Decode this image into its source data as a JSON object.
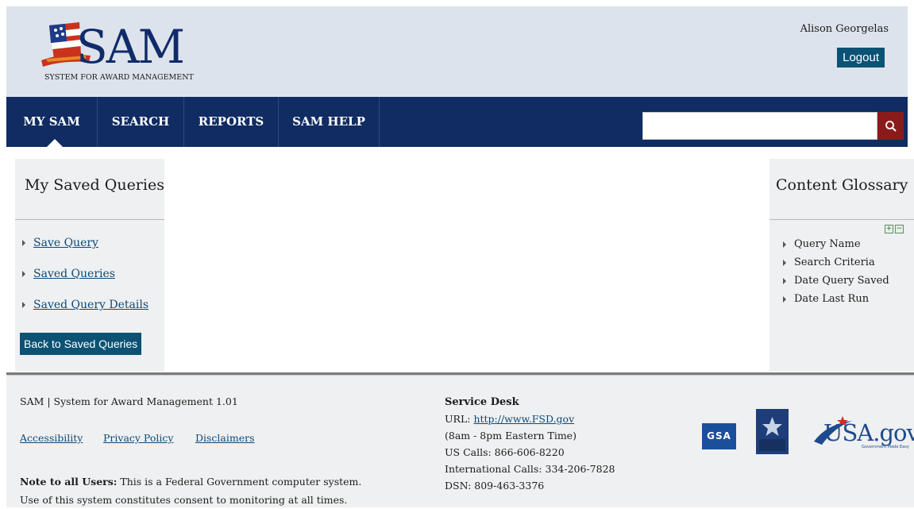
{
  "header": {
    "logo_text": "SAM",
    "logo_subtitle": "SYSTEM FOR AWARD MANAGEMENT",
    "user_name": "Alison Georgelas",
    "logout_label": "Logout"
  },
  "nav": {
    "items": [
      {
        "label": "MY SAM"
      },
      {
        "label": "SEARCH"
      },
      {
        "label": "REPORTS"
      },
      {
        "label": "SAM HELP"
      }
    ],
    "active": "MY SAM",
    "search_value": "",
    "search_icon": "magnifier-icon"
  },
  "left_panel": {
    "title": "My Saved Queries",
    "links": [
      {
        "label": "Save Query"
      },
      {
        "label": "Saved Queries"
      },
      {
        "label": "Saved Query Details"
      }
    ],
    "back_button": "Back to Saved Queries"
  },
  "right_panel": {
    "title": "Content Glossary",
    "expand_icon": "plus",
    "collapse_icon": "minus",
    "items": [
      {
        "label": "Query Name"
      },
      {
        "label": "Search Criteria"
      },
      {
        "label": "Date Query Saved"
      },
      {
        "label": "Date Last Run"
      }
    ]
  },
  "footer": {
    "app_name": "SAM | System for Award Management 1.01",
    "links": [
      {
        "label": "Accessibility"
      },
      {
        "label": "Privacy Policy"
      },
      {
        "label": "Disclaimers"
      }
    ],
    "note_label": "Note to all Users:",
    "note_text_1": " This is a Federal Government computer system.",
    "note_text_2": "Use of this system constitutes consent to monitoring at all times.",
    "service_desk": {
      "title": "Service Desk",
      "url_label": "URL: ",
      "url": "http://www.FSD.gov",
      "hours": "(8am - 8pm Eastern Time)",
      "us_calls": "US Calls: 866-606-8220",
      "intl_calls": "International Calls: 334-206-7828",
      "dsn": "DSN: 809-463-3376"
    },
    "gsa_logo": "GSA",
    "iae_logo": "Integrated Acquisition Environment",
    "usagov_logo": "USA.gov",
    "usagov_tagline": "Government Made Easy"
  },
  "colors": {
    "nav_bg": "#102c63",
    "header_bg": "#dde3ec",
    "button_bg": "#0b5274",
    "search_button_bg": "#8b1b1b",
    "link": "#0b4a7a"
  }
}
